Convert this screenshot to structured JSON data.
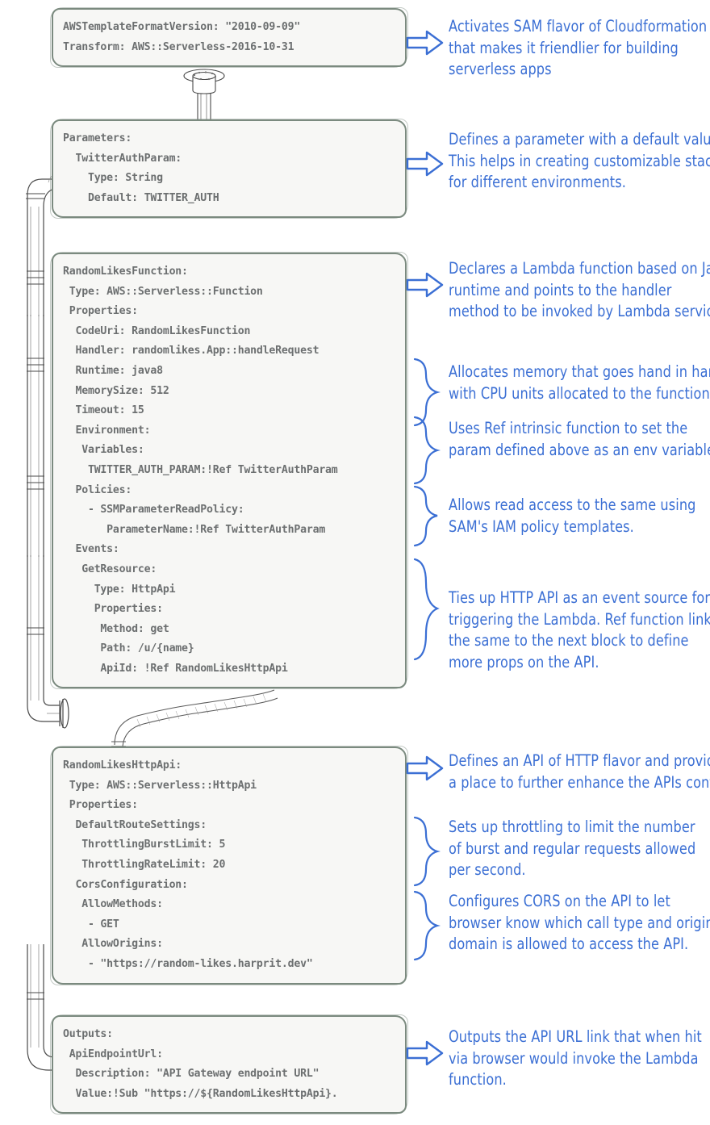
{
  "meta": {
    "accent_blue": "#3b6fd4",
    "code_text": "#6c6f70",
    "block_border": "#7b8a7f",
    "block_fill": "#f7f7f5"
  },
  "blocks": [
    {
      "id": "header-block",
      "name": "template-header-block",
      "lines": [
        "AWSTemplateFormatVersion: \"2010-09-09\"",
        "Transform: AWS::Serverless-2016-10-31"
      ]
    },
    {
      "id": "parameters-block",
      "name": "parameters-block",
      "lines": [
        "Parameters:",
        "  TwitterAuthParam:",
        "    Type: String",
        "    Default: TWITTER_AUTH"
      ]
    },
    {
      "id": "function-block",
      "name": "random-likes-function-block",
      "lines": [
        "RandomLikesFunction:",
        " Type: AWS::Serverless::Function",
        " Properties:",
        "  CodeUri: RandomLikesFunction",
        "  Handler: randomlikes.App::handleRequest",
        "  Runtime: java8",
        "  MemorySize: 512",
        "  Timeout: 15",
        "  Environment:",
        "   Variables:",
        "    TWITTER_AUTH_PARAM:!Ref TwitterAuthParam",
        "  Policies:",
        "    - SSMParameterReadPolicy:",
        "       ParameterName:!Ref TwitterAuthParam",
        "  Events:",
        "   GetResource:",
        "     Type: HttpApi",
        "     Properties:",
        "      Method: get",
        "      Path: /u/{name}",
        "      ApiId: !Ref RandomLikesHttpApi"
      ]
    },
    {
      "id": "httpapi-block",
      "name": "random-likes-http-api-block",
      "lines": [
        "RandomLikesHttpApi:",
        " Type: AWS::Serverless::HttpApi",
        " Properties:",
        "  DefaultRouteSettings:",
        "   ThrottlingBurstLimit: 5",
        "   ThrottlingRateLimit: 20",
        "  CorsConfiguration:",
        "   AllowMethods:",
        "    - GET",
        "   AllowOrigins:",
        "    - \"https://random-likes.harprit.dev\""
      ]
    },
    {
      "id": "outputs-block",
      "name": "outputs-block",
      "lines": [
        "Outputs:",
        " ApiEndpointUrl:",
        "  Description: \"API Gateway endpoint URL\"",
        "  Value:!Sub \"https://${RandomLikesHttpApi}."
      ]
    }
  ],
  "notes": [
    {
      "id": "note-transform",
      "name": "note-activates-sam",
      "marker": "arrow-right-icon",
      "lines": [
        "Activates SAM flavor of Cloudformation",
        "that makes it friendlier for building",
        "serverless apps"
      ]
    },
    {
      "id": "note-parameters",
      "name": "note-defines-parameter",
      "marker": "arrow-right-icon",
      "lines": [
        "Defines a parameter with a default value.",
        "This helps in creating customizable stacks",
        "for different environments."
      ]
    },
    {
      "id": "note-lambda",
      "name": "note-declares-lambda",
      "marker": "arrow-right-icon",
      "lines": [
        "Declares a Lambda function based on Java",
        "runtime and points to the handler",
        "method to be invoked by Lambda service."
      ]
    },
    {
      "id": "note-memory",
      "name": "note-allocates-memory",
      "marker": "brace-icon",
      "lines": [
        "Allocates memory that goes hand in hand",
        "with CPU units allocated to the function."
      ]
    },
    {
      "id": "note-ref",
      "name": "note-uses-ref-intrinsic",
      "marker": "brace-icon",
      "lines": [
        "Uses Ref intrinsic function to set the",
        "param defined above as an env variable."
      ]
    },
    {
      "id": "note-policy",
      "name": "note-allows-read-access",
      "marker": "brace-icon",
      "lines": [
        "Allows read access to the same using",
        "SAM's IAM policy templates."
      ]
    },
    {
      "id": "note-events",
      "name": "note-ties-up-http-api",
      "marker": "brace-icon",
      "lines": [
        "Ties up HTTP API as an event source for",
        "triggering the Lambda. Ref function links",
        "the same to the next block to define",
        "more props on the API."
      ]
    },
    {
      "id": "note-api",
      "name": "note-defines-api",
      "marker": "arrow-right-icon",
      "lines": [
        "Defines an API of HTTP flavor and provides",
        "a place to further enhance the APIs config."
      ]
    },
    {
      "id": "note-throttle",
      "name": "note-sets-up-throttling",
      "marker": "brace-icon",
      "lines": [
        "Sets up throttling to limit the number",
        "of burst and regular requests allowed",
        "per second."
      ]
    },
    {
      "id": "note-cors",
      "name": "note-configures-cors",
      "marker": "brace-icon",
      "lines": [
        "Configures CORS on the API to let",
        "browser know which call type and origin",
        "domain is allowed to access the API."
      ]
    },
    {
      "id": "note-outputs",
      "name": "note-outputs-api-url",
      "marker": "arrow-right-icon",
      "lines": [
        "Outputs the API URL link that when hit",
        "via browser would invoke the Lambda",
        "function."
      ]
    }
  ]
}
